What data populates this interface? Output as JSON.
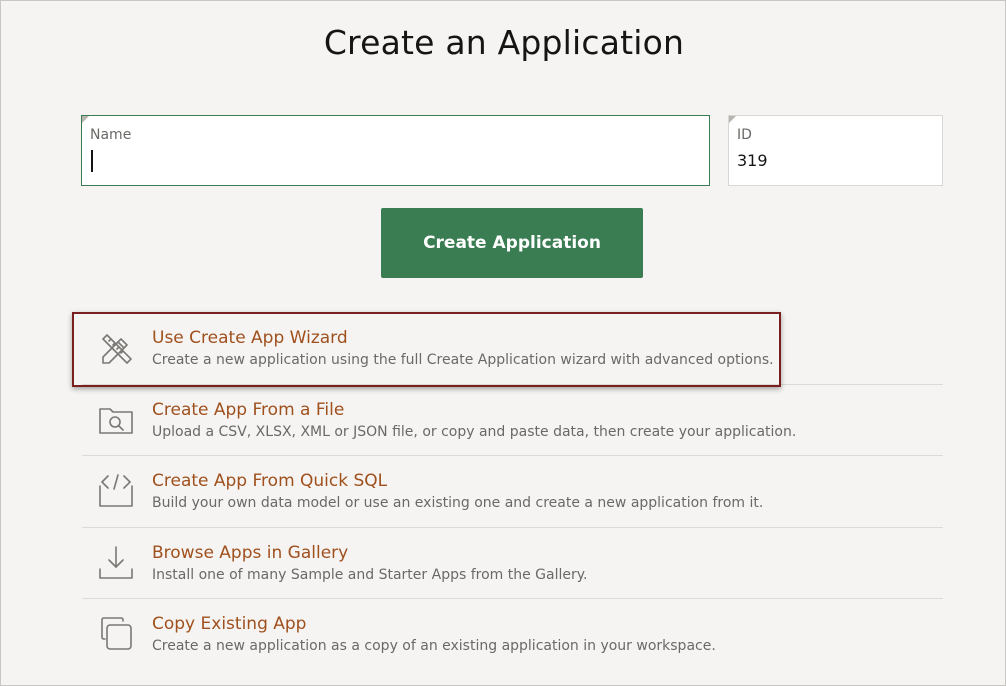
{
  "page": {
    "title": "Create an Application"
  },
  "form": {
    "name_label": "Name",
    "name_value": "",
    "id_label": "ID",
    "id_value": "319",
    "create_button": "Create Application"
  },
  "options": [
    {
      "title": "Use Create App Wizard",
      "description": "Create a new application using the full Create Application wizard with advanced options.",
      "icon": "wizard-icon",
      "selected": true
    },
    {
      "title": "Create App From a File",
      "description": "Upload a CSV, XLSX, XML or JSON file, or copy and paste data, then create your application.",
      "icon": "folder-search-icon",
      "selected": false
    },
    {
      "title": "Create App From Quick SQL",
      "description": "Build your own data model or use an existing one and create a new application from it.",
      "icon": "code-icon",
      "selected": false
    },
    {
      "title": "Browse Apps in Gallery",
      "description": "Install one of many Sample and Starter Apps from the Gallery.",
      "icon": "download-icon",
      "selected": false
    },
    {
      "title": "Copy Existing App",
      "description": "Create a new application as a copy of an existing application in your workspace.",
      "icon": "copy-icon",
      "selected": false
    }
  ],
  "colors": {
    "accent_green": "#3a7d53",
    "option_title": "#a0501d",
    "selection_border": "#7a1f1f",
    "background": "#f5f4f2"
  }
}
